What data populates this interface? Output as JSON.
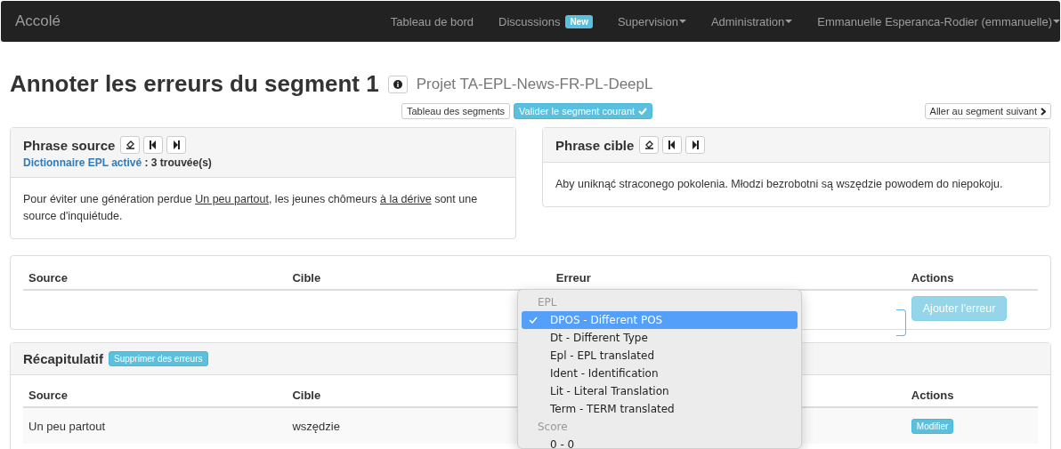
{
  "navbar": {
    "brand": "Accolé",
    "items": [
      {
        "label": "Tableau de bord",
        "caret": false
      },
      {
        "label": "Discussions",
        "badge": "New",
        "caret": false
      },
      {
        "label": "Supervision",
        "caret": true
      },
      {
        "label": "Administration",
        "caret": true
      },
      {
        "label": "Emmanuelle Esperanca-Rodier (emmanuelle)",
        "caret": true
      }
    ]
  },
  "page_title": "Annoter les erreurs du segment 1",
  "project": "Projet TA-EPL-News-FR-PL-DeepL",
  "toolbar": {
    "left": [
      "Tableau des segments"
    ],
    "primary": "Valider le segment courant",
    "right": "Aller au segment suivant"
  },
  "source_panel": {
    "title": "Phrase source",
    "dictionary_link": "Dictionnaire EPL activé",
    "dictionary_count": ": 3 trouvée(s)",
    "text_parts": [
      {
        "text": "Pour éviter une génération perdue ",
        "underlined": false
      },
      {
        "text": "Un peu partout",
        "underlined": true
      },
      {
        "text": ", les jeunes chômeurs ",
        "underlined": false
      },
      {
        "text": "à la dérive",
        "underlined": true
      },
      {
        "text": " sont une source d'inquiétude.",
        "underlined": false
      }
    ]
  },
  "target_panel": {
    "title": "Phrase cible",
    "text": "Aby uniknąć straconego pokolenia. Młodzi bezrobotni są wszędzie powodem do niepokoju."
  },
  "error_table": {
    "columns": [
      "Source",
      "Cible",
      "Erreur",
      "Actions"
    ],
    "add_button": "Ajouter l'erreur",
    "add_disabled": true
  },
  "summary": {
    "title": "Récapitulatif",
    "delete_button": "Supprimer des erreurs",
    "columns": [
      "Source",
      "Cible",
      "Actions"
    ],
    "rows": [
      {
        "source": "Un peu partout",
        "target": "wszędzie",
        "action": "Modifier"
      }
    ]
  },
  "dropdown": {
    "groups": [
      {
        "label": "EPL",
        "options": [
          {
            "label": "DPOS - Different POS",
            "selected": true
          },
          {
            "label": "Dt - Different Type",
            "selected": false
          },
          {
            "label": "Epl - EPL translated",
            "selected": false
          },
          {
            "label": "Ident - Identification",
            "selected": false
          },
          {
            "label": "Lit - Literal Translation",
            "selected": false
          },
          {
            "label": "Term - TERM translated",
            "selected": false
          }
        ]
      },
      {
        "label": "Score",
        "options": [
          {
            "label": "0 - 0",
            "selected": false
          }
        ]
      }
    ]
  }
}
